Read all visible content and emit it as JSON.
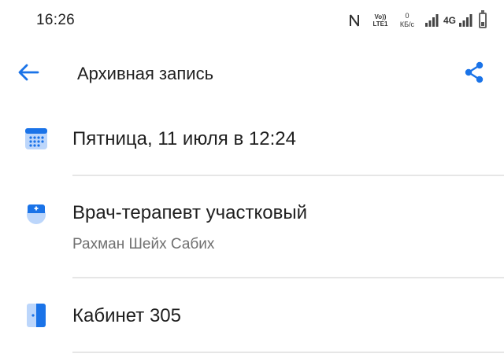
{
  "status_bar": {
    "time": "16:26",
    "volte_top": "Vo))",
    "volte_bottom": "LTE1",
    "speed_value": "0",
    "speed_unit": "КБ/с",
    "network_type": "4G"
  },
  "app_bar": {
    "title": "Архивная запись",
    "back_icon": "arrow-back-icon",
    "share_icon": "share-icon"
  },
  "details": {
    "date": {
      "icon": "calendar-icon",
      "title": "Пятница, 11 июля в 12:24"
    },
    "doctor": {
      "icon": "doctor-icon",
      "title": "Врач-терапевт участковый",
      "name": "Рахман Шейх Сабих"
    },
    "room": {
      "icon": "door-icon",
      "title": "Кабинет 305"
    }
  },
  "colors": {
    "accent": "#1a73e8",
    "icon_light": "#bcd6fb",
    "divider": "#e6e6e6",
    "secondary_text": "#707070"
  }
}
